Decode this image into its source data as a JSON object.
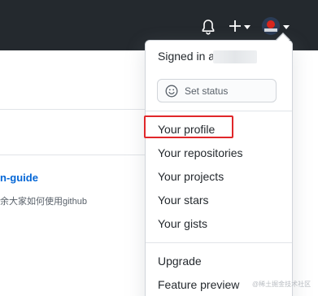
{
  "header": {
    "icons": [
      "bell-icon",
      "plus-icon",
      "chevron-down-icon",
      "avatar",
      "chevron-down-icon"
    ],
    "background_color": "#24292e"
  },
  "background_page": {
    "link_text": "n-guide",
    "description": "余大家如何使用github"
  },
  "dropdown": {
    "signed_in_prefix": "Signed in a",
    "set_status_label": "Set status",
    "profile_items": [
      "Your profile",
      "Your repositories",
      "Your projects",
      "Your stars",
      "Your gists"
    ],
    "bottom_items": [
      "Upgrade",
      "Feature preview"
    ]
  },
  "annotation": {
    "highlighted_item": "Your profile",
    "color": "#e0272a"
  },
  "watermark": "@稀土掘金技术社区"
}
